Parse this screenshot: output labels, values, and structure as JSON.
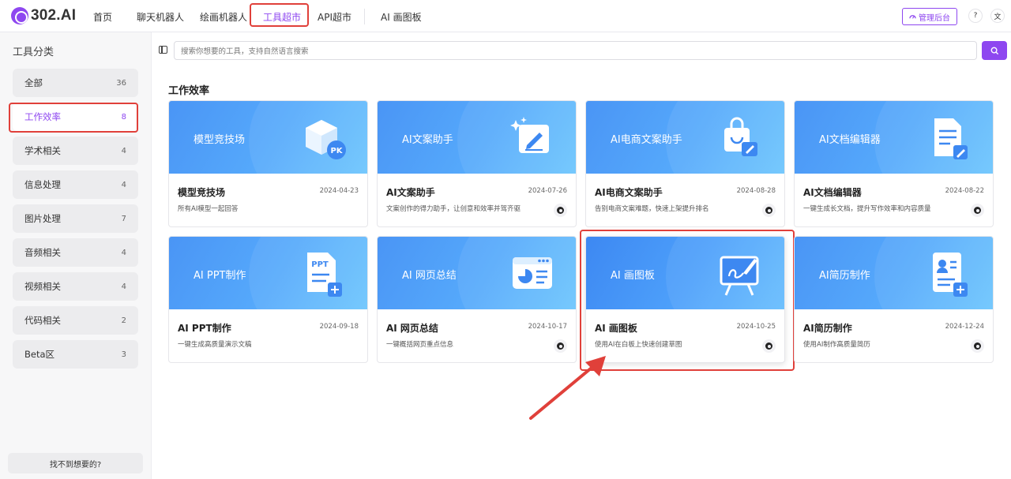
{
  "app": {
    "logo_text": "302.AI",
    "brand_color": "#8e47f0"
  },
  "nav": {
    "items": [
      {
        "label": "首页"
      },
      {
        "label": "聊天机器人"
      },
      {
        "label": "绘画机器人"
      },
      {
        "label": "工具超市",
        "active": true
      },
      {
        "label": "API超市"
      },
      {
        "label": "AI 画图板"
      }
    ],
    "admin_label": "管理后台",
    "help_icon": "help-icon",
    "translate_icon": "translate-icon"
  },
  "sidebar": {
    "title": "工具分类",
    "categories": [
      {
        "label": "全部",
        "count": "36"
      },
      {
        "label": "工作效率",
        "count": "8",
        "active": true
      },
      {
        "label": "学术相关",
        "count": "4"
      },
      {
        "label": "信息处理",
        "count": "4"
      },
      {
        "label": "图片处理",
        "count": "7"
      },
      {
        "label": "音频相关",
        "count": "4"
      },
      {
        "label": "视频相关",
        "count": "4"
      },
      {
        "label": "代码相关",
        "count": "2"
      },
      {
        "label": "Beta区",
        "count": "3"
      }
    ],
    "find_button": "找不到想要的?"
  },
  "search": {
    "placeholder": "搜索你想要的工具，支持自然语言搜索"
  },
  "section": {
    "title": "工作效率"
  },
  "tools": [
    {
      "banner": "模型竞技场",
      "name": "模型竞技场",
      "date": "2024-04-23",
      "desc": "所有AI模型一起回答",
      "icon": "pk-cube-icon"
    },
    {
      "banner": "AI文案助手",
      "name": "AI文案助手",
      "date": "2024-07-26",
      "desc": "文案创作的得力助手，让创意和效率并驾齐驱",
      "icon": "copywriting-icon"
    },
    {
      "banner": "AI电商文案助手",
      "name": "AI电商文案助手",
      "date": "2024-08-28",
      "desc": "告别电商文案难题，快速上架提升排名",
      "icon": "shopping-bag-icon"
    },
    {
      "banner": "AI文档编辑器",
      "name": "AI文档编辑器",
      "date": "2024-08-22",
      "desc": "一键生成长文档，提升写作效率和内容质量",
      "icon": "document-edit-icon"
    },
    {
      "banner": "AI PPT制作",
      "name": "AI PPT制作",
      "date": "2024-09-18",
      "desc": "一键生成高质量演示文稿",
      "icon": "ppt-icon"
    },
    {
      "banner": "AI 网页总结",
      "name": "AI 网页总结",
      "date": "2024-10-17",
      "desc": "一键概括网页重点信息",
      "icon": "webpage-summary-icon"
    },
    {
      "banner": "AI 画图板",
      "name": "AI 画图板",
      "date": "2024-10-25",
      "desc": "使用AI在白板上快速创建草图",
      "icon": "easel-icon"
    },
    {
      "banner": "AI简历制作",
      "name": "AI简历制作",
      "date": "2024-12-24",
      "desc": "使用AI制作高质量简历",
      "icon": "resume-icon"
    }
  ]
}
